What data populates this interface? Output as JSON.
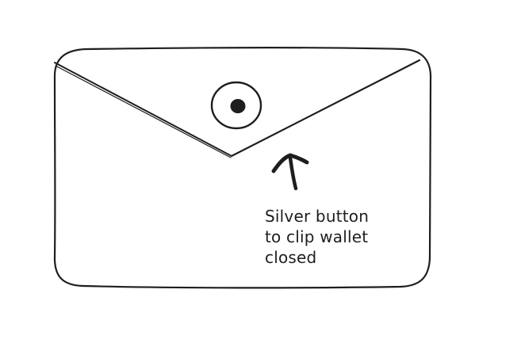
{
  "diagram": {
    "annotation_lines": [
      "Silver button",
      "to clip wallet",
      "closed"
    ]
  },
  "colors": {
    "stroke": "#1e1e1e",
    "background": "#ffffff"
  },
  "icons": {
    "envelope": "wallet-outline-icon",
    "button": "silver-button-icon",
    "arrow": "arrow-up-icon"
  }
}
